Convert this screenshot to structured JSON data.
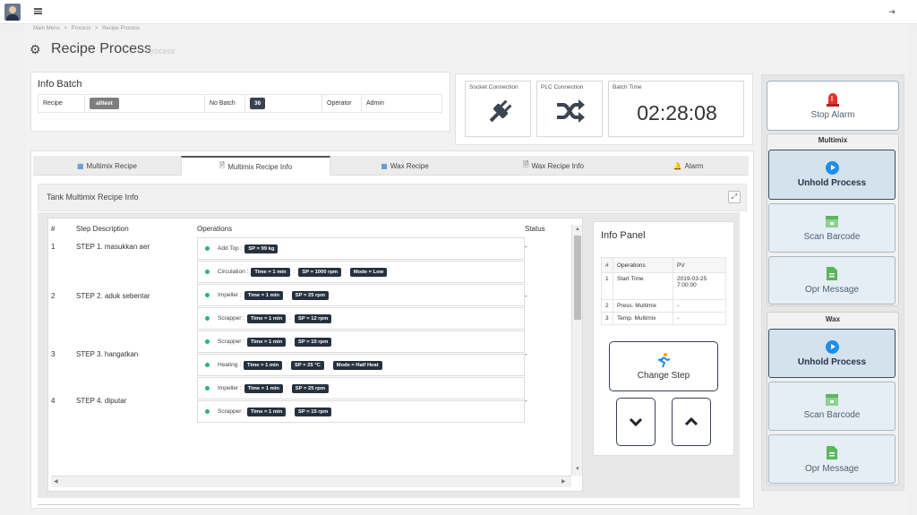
{
  "breadcrumb": {
    "items": [
      "Main Menu",
      "Process",
      "Recipe Process"
    ],
    "separator": ">"
  },
  "header": {
    "title": "Recipe Process",
    "subtitle": "Process"
  },
  "info_batch": {
    "title": "Info Batch",
    "recipe_label": "Recipe",
    "recipe_value": "alltest",
    "batch_label": "No Batch",
    "batch_value": "36",
    "operator_label": "Operator",
    "operator_value": "Admin"
  },
  "connections": {
    "socket_label": "Socket Connection",
    "plc_label": "PLC Connection",
    "batch_time_label": "Batch Time",
    "batch_time_value": "02:28:08"
  },
  "tabs": [
    {
      "label": "Multimix Recipe",
      "icon": "building-icon"
    },
    {
      "label": "Multimix Recipe Info",
      "icon": "document-icon",
      "active": true
    },
    {
      "label": "Wax Recipe",
      "icon": "building-icon"
    },
    {
      "label": "Wax Recipe Info",
      "icon": "document-icon"
    },
    {
      "label": "Alarm",
      "icon": "bell-icon"
    }
  ],
  "section": {
    "title": "Tank Multimix Recipe Info"
  },
  "steps_table": {
    "headers": [
      "#",
      "Step Description",
      "Operations",
      "Status"
    ],
    "rows": [
      {
        "no": "1",
        "desc": "STEP 1. masukkan aer",
        "status": "-",
        "ops": [
          {
            "name": "Add Top :",
            "params": [
              "SP = 99 kg"
            ]
          }
        ]
      },
      {
        "no": "2",
        "desc": "STEP 2. aduk sebentar",
        "status": "-",
        "ops": [
          {
            "name": "Circulation :",
            "params": [
              "Time = 1 min",
              "SP = 1000 rpm",
              "Mode = Low"
            ]
          },
          {
            "name": "Impeller :",
            "params": [
              "Time = 1 min",
              "SP = 25 rpm"
            ]
          },
          {
            "name": "Scrapper :",
            "params": [
              "Time = 1 min",
              "SP = 12 rpm"
            ]
          }
        ]
      },
      {
        "no": "3",
        "desc": "STEP 3. hangatkan",
        "status": "-",
        "ops": [
          {
            "name": "Scrapper :",
            "params": [
              "Time = 1 min",
              "SP = 15 rpm"
            ]
          },
          {
            "name": "Heating :",
            "params": [
              "Time = 1 min",
              "SP = 25 °C",
              "Mode = Half Heat"
            ]
          }
        ]
      },
      {
        "no": "4",
        "desc": "STEP 4. diputar",
        "status": "-",
        "ops": [
          {
            "name": "Impeller :",
            "params": [
              "Time = 1 min",
              "SP = 25 rpm"
            ]
          },
          {
            "name": "Scrapper :",
            "params": [
              "Time = 1 min",
              "SP = 15 rpm"
            ]
          }
        ]
      }
    ]
  },
  "info_panel": {
    "title": "Info Panel",
    "headers": [
      "#",
      "Operations",
      "PV"
    ],
    "rows": [
      {
        "no": "1",
        "op": "Start Time",
        "pv": "2019-03-25 7:00:00"
      },
      {
        "no": "2",
        "op": "Press. Multimix",
        "pv": "-"
      },
      {
        "no": "3",
        "op": "Temp. Multimix",
        "pv": "-"
      }
    ],
    "change_step_label": "Change Step"
  },
  "right_panel": {
    "stop_alarm_label": "Stop Alarm",
    "multimix_title": "Multimix",
    "wax_title": "Wax",
    "unhold_label": "Unhold Process",
    "scan_label": "Scan Barcode",
    "opr_label": "Opr Message"
  },
  "colors": {
    "accent": "#1e8fe8",
    "badge_dark": "#26313f",
    "status_dot": "#2ab08a",
    "alarm_red": "#e5312f"
  }
}
